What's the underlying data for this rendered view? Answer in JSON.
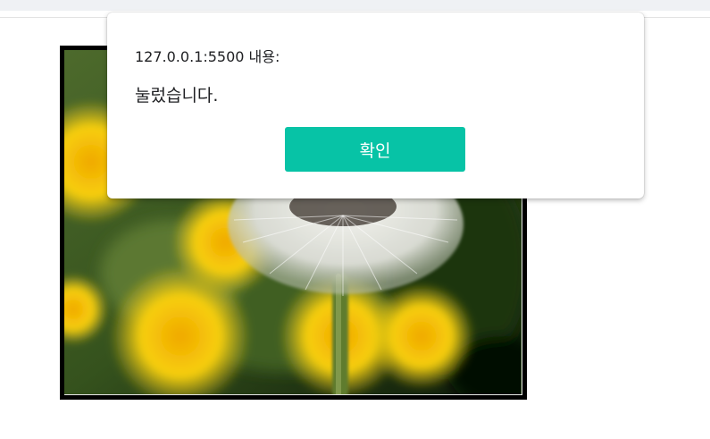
{
  "dialog": {
    "origin_text": "127.0.0.1:5500 내용:",
    "message": "눌렀습니다.",
    "ok_label": "확인",
    "ok_color": "#07c3a6"
  },
  "photo": {
    "subject": "dandelion-seed-head",
    "frame_color": "#000000"
  }
}
